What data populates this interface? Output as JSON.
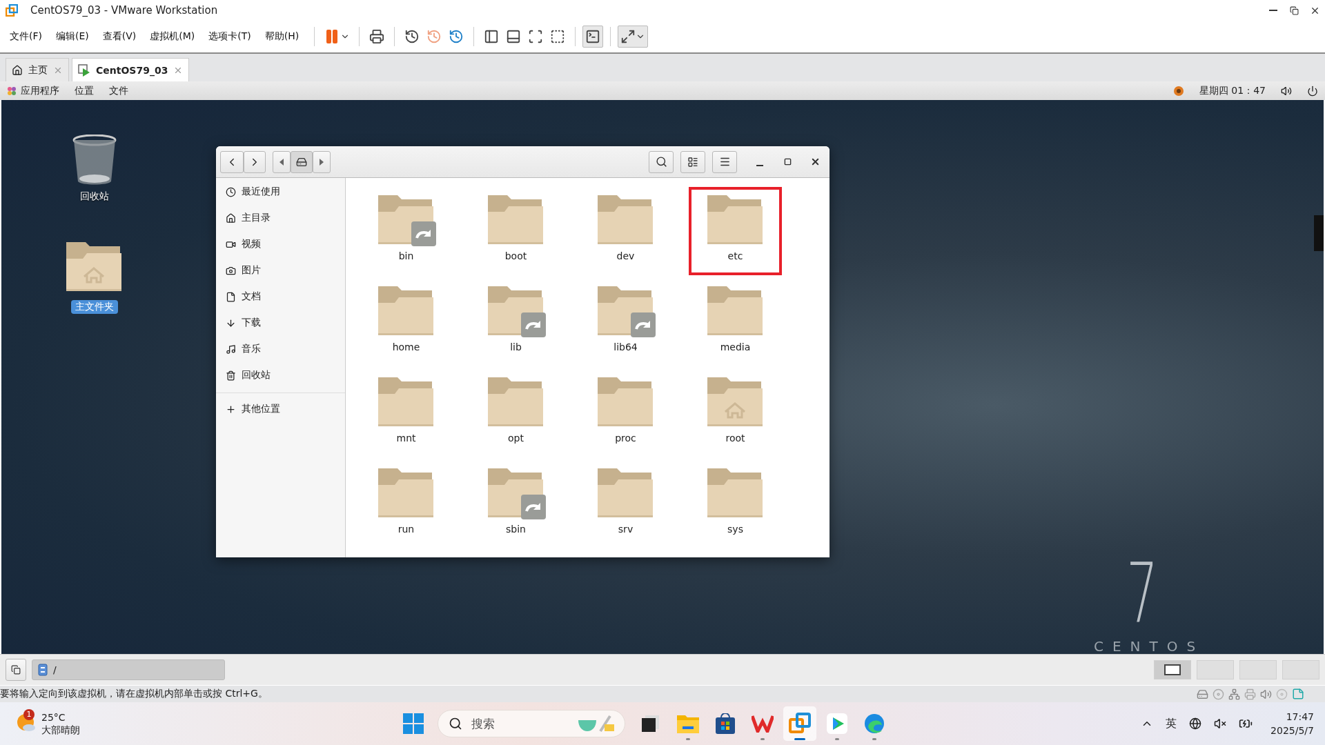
{
  "window": {
    "title": "CentOS79_03 - VMware Workstation"
  },
  "menu": [
    "文件(F)",
    "编辑(E)",
    "查看(V)",
    "虚拟机(M)",
    "选项卡(T)",
    "帮助(H)"
  ],
  "tabs": [
    {
      "label": "主页",
      "kind": "home",
      "selected": false
    },
    {
      "label": "CentOS79_03",
      "kind": "vm",
      "selected": true
    }
  ],
  "guest_top_bar": {
    "menus": [
      "应用程序",
      "位置",
      "文件"
    ],
    "clock": "星期四 01：47"
  },
  "desktop_icons": [
    {
      "label": "回收站",
      "kind": "trash",
      "selected": false
    },
    {
      "label": "主文件夹",
      "kind": "home",
      "selected": true
    }
  ],
  "file_manager": {
    "sidebar": [
      {
        "label": "最近使用",
        "kind": "recent"
      },
      {
        "label": "主目录",
        "kind": "home"
      },
      {
        "label": "视频",
        "kind": "video"
      },
      {
        "label": "图片",
        "kind": "photo"
      },
      {
        "label": "文档",
        "kind": "document"
      },
      {
        "label": "下载",
        "kind": "download"
      },
      {
        "label": "音乐",
        "kind": "music"
      },
      {
        "label": "回收站",
        "kind": "trash"
      }
    ],
    "other_places": "其他位置",
    "files": [
      {
        "name": "bin",
        "kind": "link",
        "highlighted": false
      },
      {
        "name": "boot",
        "kind": "folder",
        "highlighted": false
      },
      {
        "name": "dev",
        "kind": "folder",
        "highlighted": false
      },
      {
        "name": "etc",
        "kind": "folder",
        "highlighted": true
      },
      {
        "name": "home",
        "kind": "folder",
        "highlighted": false
      },
      {
        "name": "lib",
        "kind": "link",
        "highlighted": false
      },
      {
        "name": "lib64",
        "kind": "link",
        "highlighted": false
      },
      {
        "name": "media",
        "kind": "folder",
        "highlighted": false
      },
      {
        "name": "mnt",
        "kind": "folder",
        "highlighted": false
      },
      {
        "name": "opt",
        "kind": "folder",
        "highlighted": false
      },
      {
        "name": "proc",
        "kind": "folder",
        "highlighted": false
      },
      {
        "name": "root",
        "kind": "home",
        "highlighted": false
      },
      {
        "name": "run",
        "kind": "folder",
        "highlighted": false
      },
      {
        "name": "sbin",
        "kind": "link",
        "highlighted": false
      },
      {
        "name": "srv",
        "kind": "folder",
        "highlighted": false
      },
      {
        "name": "sys",
        "kind": "folder",
        "highlighted": false
      }
    ]
  },
  "wallpaper": {
    "version": "7",
    "brand": "CENTOS"
  },
  "vm_bar": {
    "path": "/",
    "message": "要将输入定向到该虚拟机，请在虚拟机内部单击或按 Ctrl+G。"
  },
  "taskbar": {
    "weather": {
      "badge": "1",
      "temperature": "25°C",
      "condition": "大部晴朗"
    },
    "search_placeholder": "搜索",
    "apps": [
      {
        "kind": "taskview",
        "running": false,
        "selected": false
      },
      {
        "kind": "explorer",
        "running": true,
        "selected": false
      },
      {
        "kind": "store",
        "running": false,
        "selected": false
      },
      {
        "kind": "wps",
        "running": true,
        "selected": false
      },
      {
        "kind": "vmware",
        "running": true,
        "selected": true
      },
      {
        "kind": "player",
        "running": true,
        "selected": false
      },
      {
        "kind": "edge",
        "running": true,
        "selected": false
      }
    ],
    "input_method": "英",
    "time": "17:47",
    "date": "2025/5/7"
  }
}
